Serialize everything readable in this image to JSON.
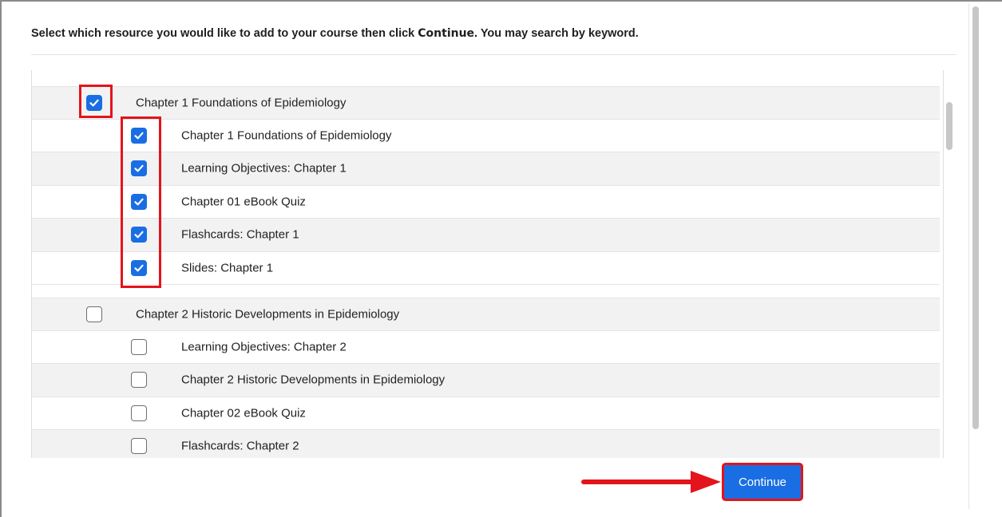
{
  "instruction": {
    "before": "Select which resource you would like to add to your course then click ",
    "strong": "Continue",
    "after": ". You may search by keyword."
  },
  "groups": [
    {
      "title": "Chapter 1 Foundations of Epidemiology",
      "checked": true,
      "items": [
        {
          "label": "Chapter 1 Foundations of Epidemiology",
          "checked": true
        },
        {
          "label": "Learning Objectives: Chapter 1",
          "checked": true
        },
        {
          "label": "Chapter 01 eBook Quiz",
          "checked": true
        },
        {
          "label": "Flashcards: Chapter 1",
          "checked": true
        },
        {
          "label": "Slides: Chapter 1",
          "checked": true
        }
      ]
    },
    {
      "title": "Chapter 2 Historic Developments in Epidemiology",
      "checked": false,
      "items": [
        {
          "label": "Learning Objectives: Chapter 2",
          "checked": false
        },
        {
          "label": "Chapter 2 Historic Developments in Epidemiology",
          "checked": false
        },
        {
          "label": "Chapter 02 eBook Quiz",
          "checked": false
        },
        {
          "label": "Flashcards: Chapter 2",
          "checked": false
        }
      ]
    }
  ],
  "continue_button": {
    "label": "Continue"
  },
  "colors": {
    "accent": "#1a6ee3",
    "highlight": "#e3141b",
    "row_shade": "#f2f2f2"
  },
  "icons": {
    "checkbox_checked": "check-icon",
    "annotation_arrow": "arrow-right-icon"
  }
}
